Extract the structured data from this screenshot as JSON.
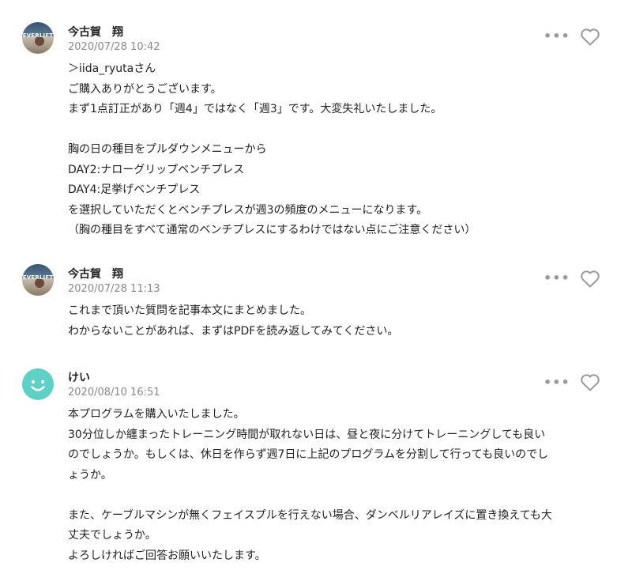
{
  "comments": [
    {
      "author": "今古賀　翔",
      "avatar_text": "EVERLIFT",
      "date": "2020/07/28 10:42",
      "lines": [
        "＞iida_ryutaさん",
        "ご購入ありがとうございます。",
        "まず1点訂正があり「週4」ではなく「週3」です。大変失礼いたしました。",
        "",
        "胸の日の種目をプルダウンメニューから",
        "DAY2:ナローグリップベンチプレス",
        "DAY4:足挙げベンチプレス",
        "を選択していただくとベンチプレスが週3の頻度のメニューになります。",
        "（胸の種目をすべて通常のベンチプレスにするわけではない点にご注意ください）"
      ]
    },
    {
      "author": "今古賀　翔",
      "avatar_text": "EVERLIFT",
      "date": "2020/07/28 11:13",
      "lines": [
        "これまで頂いた質問を記事本文にまとめました。",
        "わからないことがあれば、まずはPDFを読み返してみてください。"
      ]
    },
    {
      "author": "けい",
      "date": "2020/08/10 16:51",
      "lines": [
        "本プログラムを購入いたしました。",
        "30分位しか纏まったトレーニング時間が取れない日は、昼と夜に分けてトレーニングしても良い",
        "のでしょうか。もしくは、休日を作らず週7日に上記のプログラムを分割して行っても良いのでし",
        "ょうか。",
        "",
        "また、ケーブルマシンが無くフェイスプルを行えない場合、ダンベルリアレイズに置き換えても大",
        "丈夫でしょうか。",
        "よろしければご回答お願いいたします。"
      ]
    }
  ],
  "icons": {
    "more": "ellipsis-icon",
    "like": "heart-outline-icon"
  },
  "colors": {
    "text": "#222222",
    "meta": "#888888",
    "icon": "#9a9a9a",
    "smile_avatar": "#5ed0c6"
  }
}
